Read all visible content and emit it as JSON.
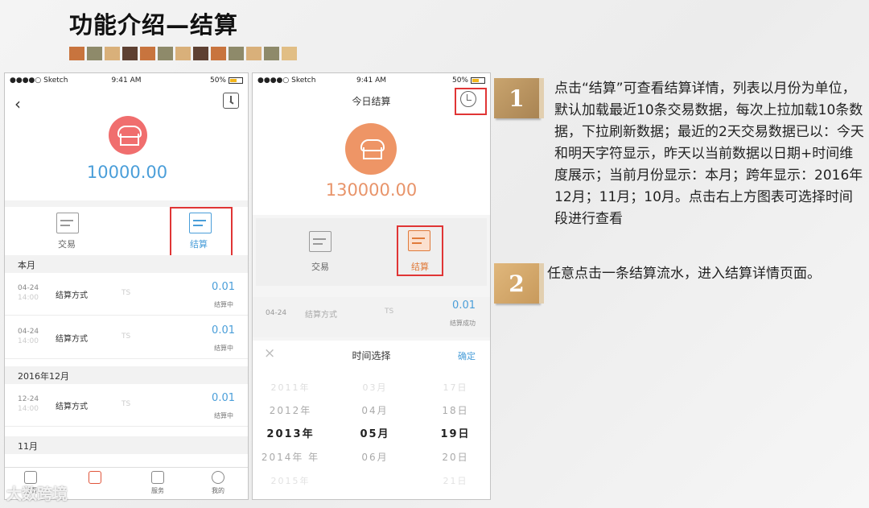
{
  "slide": {
    "title": "功能介绍—结算",
    "palette": [
      "#c8743e",
      "#8e8a6a",
      "#d9b07a",
      "#5e4032",
      "#c8743e",
      "#8e8a6a",
      "#d9b07a",
      "#5e4032",
      "#c8743e",
      "#8e8a6a",
      "#d9b07a",
      "#8e8a6a",
      "#e1be85"
    ]
  },
  "phone1": {
    "status": {
      "carrier": "●●●●○ Sketch",
      "time": "9:41 AM",
      "battery": "50%"
    },
    "amount": "10000.00",
    "tabs": [
      {
        "label": "交易"
      },
      {
        "label": "结算"
      }
    ],
    "sections": [
      {
        "header": "本月",
        "rows": [
          {
            "date": "04-24",
            "time": "14:00",
            "method": "结算方式",
            "ts": "TS",
            "amount": "0.01",
            "status": "结算中"
          },
          {
            "date": "04-24",
            "time": "14:00",
            "method": "结算方式",
            "ts": "TS",
            "amount": "0.01",
            "status": "结算中"
          }
        ]
      },
      {
        "header": "2016年12月",
        "rows": [
          {
            "date": "12-24",
            "time": "14:00",
            "method": "结算方式",
            "ts": "TS",
            "amount": "0.01",
            "status": "结算中"
          }
        ]
      },
      {
        "header": "11月",
        "rows": []
      }
    ],
    "nav": [
      {
        "label": "首页"
      },
      {
        "label": ""
      },
      {
        "label": "服务"
      },
      {
        "label": "我的"
      }
    ]
  },
  "phone2": {
    "status": {
      "carrier": "●●●●○ Sketch",
      "time": "9:41 AM",
      "battery": "50%"
    },
    "title": "今日结算",
    "amount": "130000.00",
    "tabs": [
      {
        "label": "交易"
      },
      {
        "label": "结算"
      }
    ],
    "row": {
      "date": "04-24",
      "method": "结算方式",
      "ts": "TS",
      "amount": "0.01",
      "status": "结算成功"
    },
    "picker": {
      "close": "×",
      "title": "时间选择",
      "confirm": "确定",
      "years": [
        "2011年",
        "2012年",
        "2013年",
        "2014年 年",
        "2015年"
      ],
      "months": [
        "03月",
        "04月",
        "05月",
        "06月",
        ""
      ],
      "days": [
        "17日",
        "18日",
        "19日",
        "20日",
        "21日"
      ]
    }
  },
  "steps": [
    {
      "num": "1",
      "text": "点击“结算”可查看结算详情，列表以月份为单位，默认加载最近10条交易数据，每次上拉加载10条数据，下拉刷新数据；最近的2天交易数据已以：今天和明天字符显示，昨天以当前数据以日期+时间维度展示；当前月份显示：本月；跨年显示：2016年12月；11月；10月。点击右上方图表可选择时间段进行查看"
    },
    {
      "num": "2",
      "text": "任意点击一条结算流水，进入结算详情页面。"
    }
  ],
  "watermark": "大数跨境"
}
